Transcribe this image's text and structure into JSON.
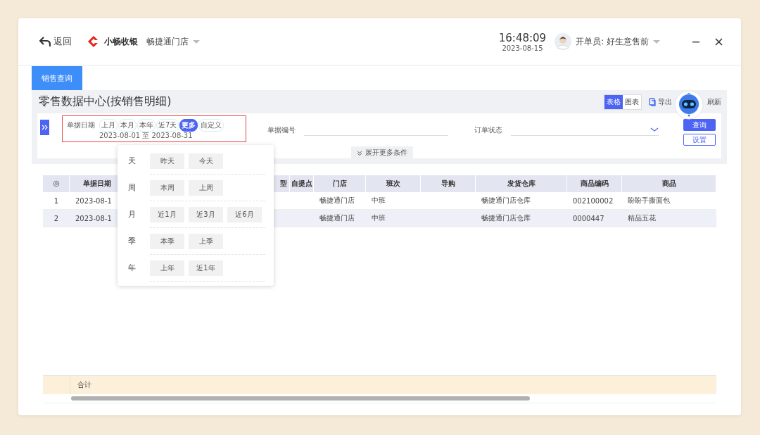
{
  "header": {
    "back": "返回",
    "brand": "小畅收银",
    "store": "畅捷通门店",
    "time": "16:48:09",
    "date": "2023-08-15",
    "operator": "开单员: 好生意售前"
  },
  "tabs": [
    {
      "label": "销售查询",
      "selected": true
    }
  ],
  "page_title": "零售数据中心(按销售明细)",
  "view_toggle": [
    {
      "label": "表格",
      "selected": true
    },
    {
      "label": "图表",
      "selected": false
    }
  ],
  "actions": {
    "export": "导出",
    "refresh": "刷新"
  },
  "filters": {
    "date_label": "单据日期",
    "date_chips": [
      {
        "label": "上月",
        "selected": false
      },
      {
        "label": "本月",
        "selected": false
      },
      {
        "label": "本年",
        "selected": false
      },
      {
        "label": "近7天",
        "selected": false
      },
      {
        "label": "更多",
        "selected": true
      },
      {
        "label": "自定义",
        "selected": false
      }
    ],
    "date_range": "2023-08-01 至 2023-08-31",
    "doc_no_label": "单据编号",
    "status_label": "订单状态",
    "expand": "展开更多条件",
    "query": "查询",
    "settings": "设置"
  },
  "date_popup": [
    {
      "unit": "天",
      "options": [
        "昨天",
        "今天"
      ]
    },
    {
      "unit": "周",
      "options": [
        "本周",
        "上周"
      ]
    },
    {
      "unit": "月",
      "options": [
        "近1月",
        "近3月",
        "近6月"
      ]
    },
    {
      "unit": "季",
      "options": [
        "本季",
        "上季"
      ]
    },
    {
      "unit": "年",
      "options": [
        "上年",
        "近1年"
      ]
    }
  ],
  "table": {
    "columns": [
      "单据日期",
      "型",
      "自提点",
      "门店",
      "班次",
      "导购",
      "发货仓库",
      "商品编码",
      "商品"
    ],
    "rows": [
      {
        "index": "1",
        "selected": false,
        "cells": [
          "2023-08-1",
          "",
          "",
          "畅捷通门店",
          "中班",
          "",
          "畅捷通门店仓库",
          "002100002",
          "盼盼手撕面包"
        ]
      },
      {
        "index": "2",
        "selected": true,
        "cells": [
          "2023-08-1",
          "",
          "",
          "畅捷通门店",
          "中班",
          "",
          "畅捷通门店仓库",
          "0000447",
          "精品五花"
        ]
      }
    ],
    "footer": "合计"
  }
}
